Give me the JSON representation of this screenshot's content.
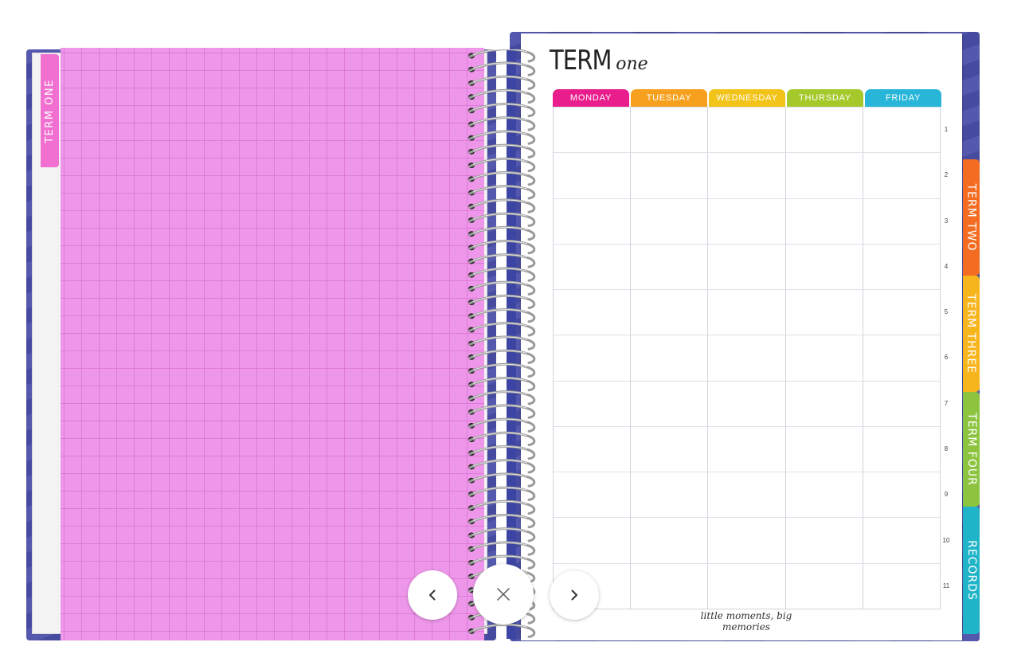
{
  "left_page": {
    "tab_label": "TERM ONE",
    "tab_color": "#f06fd0",
    "grid_color": "#ee97ea"
  },
  "right_page": {
    "title_main": "TERM",
    "title_script": "one",
    "days": [
      {
        "label": "MONDAY",
        "color": "#e91e8c"
      },
      {
        "label": "TUESDAY",
        "color": "#f7a01d"
      },
      {
        "label": "WEDNESDAY",
        "color": "#f2c318"
      },
      {
        "label": "THURSDAY",
        "color": "#a5c92b"
      },
      {
        "label": "FRIDAY",
        "color": "#27b5d8"
      }
    ],
    "rows": [
      "1",
      "2",
      "3",
      "4",
      "5",
      "6",
      "7",
      "8",
      "9",
      "10",
      "11"
    ],
    "footer": "little moments, big memories"
  },
  "side_tabs": [
    {
      "label": "TERM TWO",
      "color": "#f36c21"
    },
    {
      "label": "TERM THREE",
      "color": "#f7b51d"
    },
    {
      "label": "TERM FOUR",
      "color": "#8cc43f"
    },
    {
      "label": "RECORDS",
      "color": "#1fb4c8"
    }
  ],
  "nav": {
    "prev_icon": "chevron-left-icon",
    "close_icon": "close-icon",
    "next_icon": "chevron-right-icon"
  }
}
